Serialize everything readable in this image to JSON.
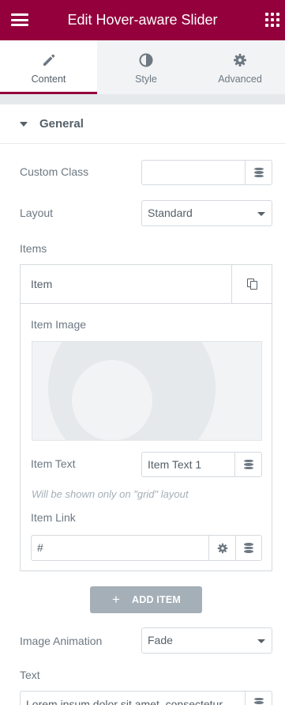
{
  "header": {
    "title": "Edit Hover-aware Slider",
    "menu_icon": "hamburger-icon",
    "apps_icon": "grid-icon"
  },
  "tabs": [
    {
      "label": "Content",
      "icon": "pencil-icon",
      "active": true
    },
    {
      "label": "Style",
      "icon": "half-circle-icon",
      "active": false
    },
    {
      "label": "Advanced",
      "icon": "gear-icon",
      "active": false
    }
  ],
  "section": {
    "title": "General",
    "expanded": true
  },
  "fields": {
    "custom_class": {
      "label": "Custom Class",
      "value": ""
    },
    "layout": {
      "label": "Layout",
      "value": "Standard"
    },
    "items_label": "Items",
    "image_animation": {
      "label": "Image Animation",
      "value": "Fade"
    },
    "text": {
      "label": "Text",
      "value": "Lorem ipsum dolor sit amet, consectetur"
    }
  },
  "repeater": {
    "item_title": "Item",
    "item_image_label": "Item Image",
    "item_text_label": "Item Text",
    "item_text_value": "Item Text 1",
    "item_text_help": "Will be shown only on \"grid\" layout",
    "item_link_label": "Item Link",
    "item_link_value": "#",
    "add_item_label": "ADD ITEM",
    "add_item_icon": "+"
  },
  "colors": {
    "brand": "#93003c",
    "panel_separator": "#e6e9ec",
    "add_button": "#a4afb7"
  }
}
